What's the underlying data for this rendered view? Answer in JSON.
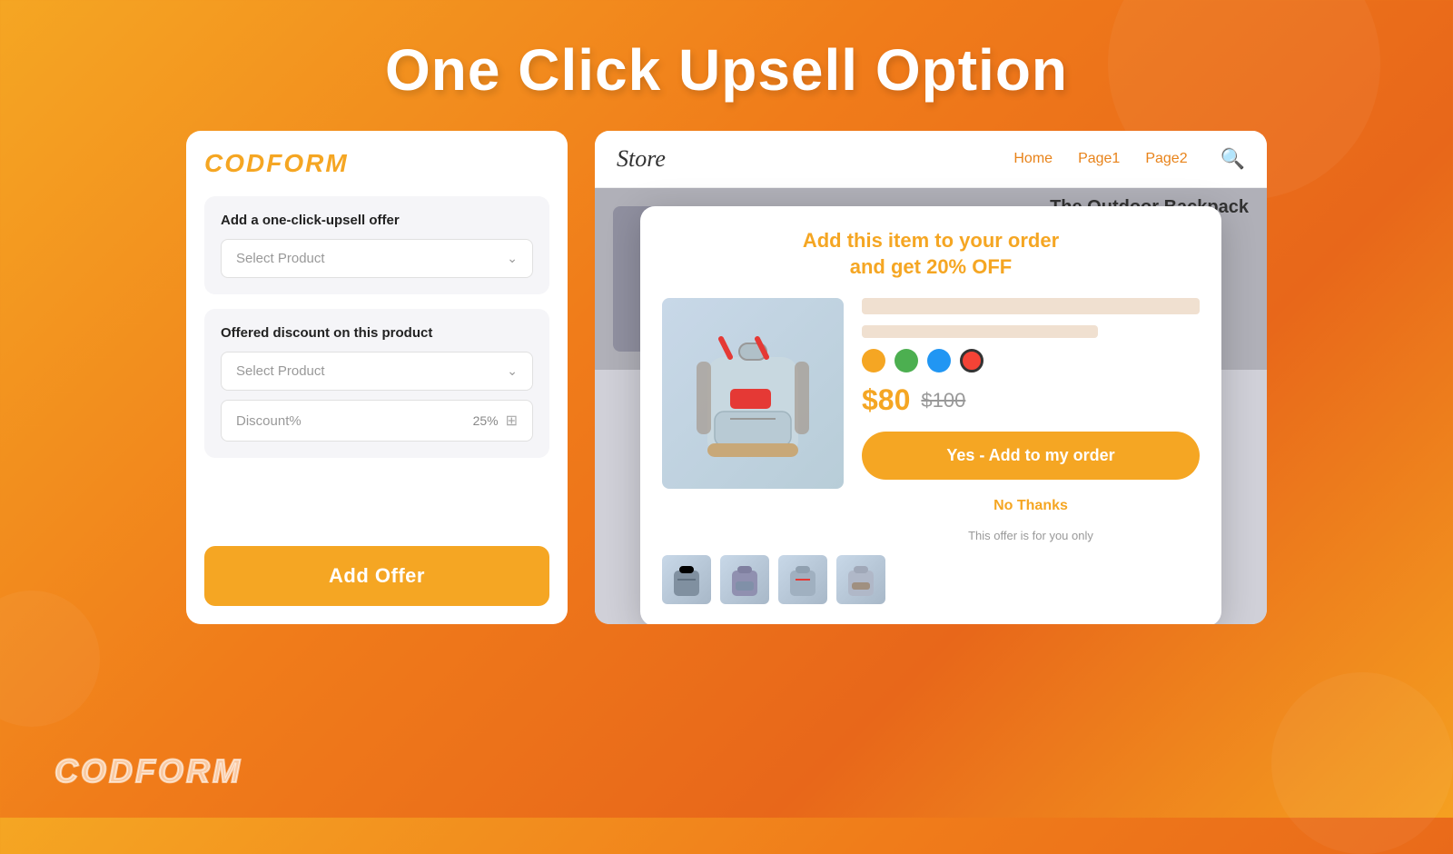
{
  "page": {
    "title": "One Click Upsell Option",
    "bg_gradient_start": "#f5a623",
    "bg_gradient_end": "#e8671a"
  },
  "left_panel": {
    "logo": "CODFORM",
    "section1": {
      "label": "Add a one-click-upsell offer",
      "dropdown_placeholder": "Select Product"
    },
    "section2": {
      "label": "Offered discount on this product",
      "dropdown_placeholder": "Select Product",
      "discount_label": "Discount%",
      "discount_value": "25%"
    },
    "add_offer_btn": "Add Offer"
  },
  "right_panel": {
    "store_logo": "Store",
    "nav_links": [
      "Home",
      "Page1",
      "Page2"
    ],
    "product_title_bg": "The Outdoor Backpack",
    "popup": {
      "title": "Add this item to your order\nand get 20% OFF",
      "price_new": "$80",
      "price_old": "$100",
      "yes_btn": "Yes - Add to my order",
      "no_thanks": "No Thanks",
      "offer_note": "This offer is for you only",
      "colors": [
        "orange",
        "green",
        "blue",
        "red"
      ]
    }
  },
  "watermark": "CODFORM",
  "icons": {
    "chevron": "›",
    "search": "🔍",
    "stepper": "⊞"
  }
}
